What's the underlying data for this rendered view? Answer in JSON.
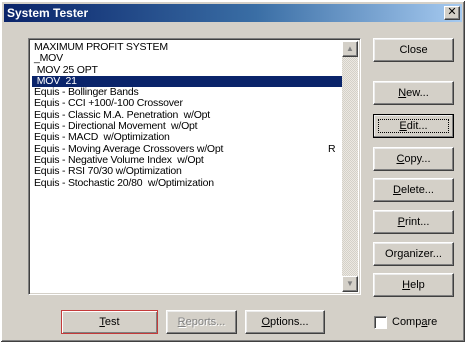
{
  "window": {
    "title": "System Tester",
    "close_glyph": "✕"
  },
  "systems": [
    {
      "label": "MAXIMUM PROFIT SYSTEM",
      "mark": "",
      "selected": false
    },
    {
      "label": "_MOV",
      "mark": "",
      "selected": false
    },
    {
      "label": " MOV 25 OPT",
      "mark": "",
      "selected": false
    },
    {
      "label": " MOV  21",
      "mark": "",
      "selected": true
    },
    {
      "label": "Equis - Bollinger Bands",
      "mark": "",
      "selected": false
    },
    {
      "label": "Equis - CCI +100/-100 Crossover",
      "mark": "",
      "selected": false
    },
    {
      "label": "Equis - Classic M.A. Penetration  w/Opt",
      "mark": "",
      "selected": false
    },
    {
      "label": "Equis - Directional Movement  w/Opt",
      "mark": "",
      "selected": false
    },
    {
      "label": "Equis - MACD  w/Optimization",
      "mark": "",
      "selected": false
    },
    {
      "label": "Equis - Moving Average Crossovers w/Opt",
      "mark": "R",
      "selected": false
    },
    {
      "label": "Equis - Negative Volume Index  w/Opt",
      "mark": "",
      "selected": false
    },
    {
      "label": "Equis - RSI 70/30 w/Optimization",
      "mark": "",
      "selected": false
    },
    {
      "label": "Equis - Stochastic 20/80  w/Optimization",
      "mark": "",
      "selected": false
    }
  ],
  "scroll": {
    "up_glyph": "▲",
    "down_glyph": "▼"
  },
  "buttons": {
    "close": "Close",
    "new_accel": "N",
    "new_rest": "ew...",
    "edit_accel": "E",
    "edit_rest": "dit...",
    "copy_accel": "C",
    "copy_rest": "opy...",
    "delete_accel": "D",
    "delete_rest": "elete...",
    "print_accel": "P",
    "print_rest": "rint...",
    "organizer_pre": "Or",
    "organizer_accel": "g",
    "organizer_rest": "anizer...",
    "help_accel": "H",
    "help_rest": "elp",
    "test_accel": "T",
    "test_rest": "est",
    "reports_accel": "R",
    "reports_rest": "eports...",
    "options_accel": "O",
    "options_rest": "ptions..."
  },
  "compare": {
    "pre": "Comp",
    "accel": "a",
    "rest": "re",
    "checked": false
  }
}
